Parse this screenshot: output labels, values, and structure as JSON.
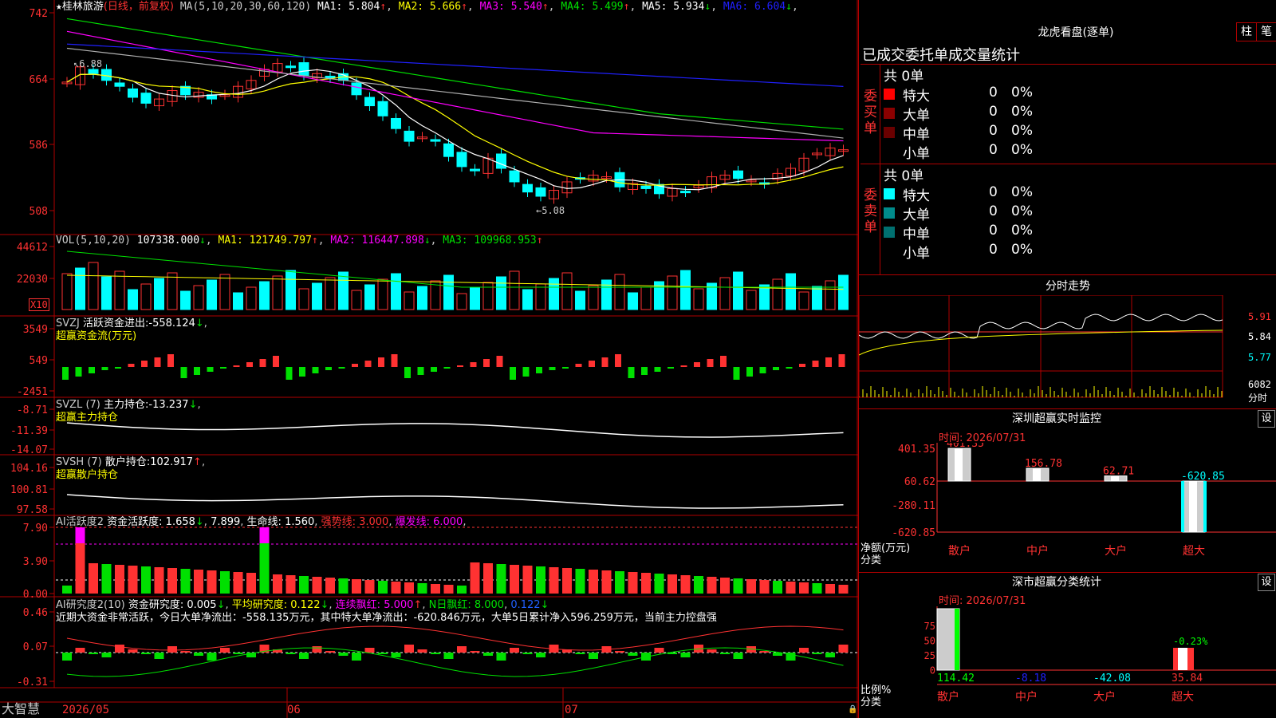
{
  "stock": {
    "star": "★",
    "name": "桂林旅游",
    "period": "(日线，前复权)",
    "ma_label": "MA(5,10,20,30,60,120)"
  },
  "colors": {
    "up": "#ff3232",
    "down": "#00ffff",
    "bg": "#000000",
    "grid": "#b00000",
    "white": "#ffffff",
    "yellow": "#ffff00",
    "magenta": "#ff00ff",
    "green": "#00e000",
    "blue": "#2020ff",
    "gray": "#b0b0b0"
  },
  "main_chart": {
    "ma_values": [
      {
        "label": "MA1:",
        "value": "5.804",
        "arrow": "↑",
        "color": "#ffffff"
      },
      {
        "label": "MA2:",
        "value": "5.666",
        "arrow": "↑",
        "color": "#ffff00"
      },
      {
        "label": "MA3:",
        "value": "5.540",
        "arrow": "↑",
        "color": "#ff00ff"
      },
      {
        "label": "MA4:",
        "value": "5.499",
        "arrow": "↑",
        "color": "#00e000"
      },
      {
        "label": "MA5:",
        "value": "5.934",
        "arrow": "↓",
        "color": "#ffffff"
      },
      {
        "label": "MA6:",
        "value": "6.604",
        "arrow": "↓",
        "color": "#2020ff"
      }
    ],
    "y_ticks": [
      "742",
      "664",
      "586",
      "508"
    ],
    "high_mark": "6.88",
    "low_mark": "5.08"
  },
  "vol_panel": {
    "label": "VOL(5,10,20)",
    "value": "107338.000",
    "arrow": "↓",
    "ma1": "MA1: 121749.797",
    "ma1_arrow": "↑",
    "ma2": "MA2: 116447.898",
    "ma2_arrow": "↓",
    "ma3": "MA3: 109968.953",
    "ma3_arrow": "↑",
    "y_ticks": [
      "44612",
      "22030"
    ],
    "unit": "X10"
  },
  "svzj_panel": {
    "name": "SVZJ",
    "title": "活跃资金进出:",
    "value": "-558.124",
    "arrow": "↓",
    "sub": "超赢资金流(万元)",
    "y_ticks": [
      "3549",
      "549",
      "-2451"
    ]
  },
  "svzl_panel": {
    "name": "SVZL",
    "param": "(7)",
    "title": "主力持仓:",
    "value": "-13.237",
    "arrow": "↓",
    "sub": "超赢主力持仓",
    "y_ticks": [
      "-8.71",
      "-11.39",
      "-14.07"
    ]
  },
  "svsh_panel": {
    "name": "SVSH",
    "param": "(7)",
    "title": "散户持仓:",
    "value": "102.917",
    "arrow": "↑",
    "sub": "超赢散户持仓",
    "y_ticks": [
      "104.16",
      "100.81",
      "97.58"
    ]
  },
  "ai_active_panel": {
    "label": "AI活跃度2",
    "t1": "资金活跃度:",
    "v1": "1.658",
    "a1": "↓",
    "v2": "7.899",
    "t3": "生命线:",
    "v3": "1.560",
    "t4": "强势线:",
    "v4": "3.000",
    "t5": "爆发线:",
    "v5": "6.000",
    "y_ticks": [
      "7.90",
      "3.90",
      "0.00"
    ]
  },
  "ai_research_panel": {
    "label": "AI研究度2(10)",
    "t1": "资金研究度:",
    "v1": "0.005",
    "a1": "↓",
    "t2": "平均研究度:",
    "v2": "0.122",
    "a2": "↓",
    "t3": "连续飘红:",
    "v3": "5.000",
    "a3": "↑",
    "t4": "N日飘红:",
    "v4": "8.000",
    "v5": "0.122",
    "a5": "↓",
    "summary": "近期大资金非常活跃，今日大单净流出：-558.135万元，其中特大单净流出：-620.846万元，大单5日累计净入596.259万元，当前主力控盘强",
    "y_ticks": [
      "0.46",
      "0.07",
      "-0.31"
    ]
  },
  "x_axis": {
    "labels": [
      "2026/05",
      "06",
      "07"
    ]
  },
  "brand": "大智慧",
  "lhb": {
    "title": "龙虎看盘(逐单)",
    "btn1": "柱",
    "btn2": "笔",
    "subtitle": "已成交委托单成交量统计",
    "buy": {
      "side": "委买单",
      "total": "共 0单",
      "rows": [
        {
          "name": "特大",
          "count": "0",
          "pct": "0%",
          "color": "#ff0000"
        },
        {
          "name": "大单",
          "count": "0",
          "pct": "0%",
          "color": "#8b0000"
        },
        {
          "name": "中单",
          "count": "0",
          "pct": "0%",
          "color": "#6a0000"
        },
        {
          "name": "小单",
          "count": "0",
          "pct": "0%",
          "color": "#000000"
        }
      ]
    },
    "sell": {
      "side": "委卖单",
      "total": "共 0单",
      "rows": [
        {
          "name": "特大",
          "count": "0",
          "pct": "0%",
          "color": "#00ffff"
        },
        {
          "name": "大单",
          "count": "0",
          "pct": "0%",
          "color": "#008b8b"
        },
        {
          "name": "中单",
          "count": "0",
          "pct": "0%",
          "color": "#007070"
        },
        {
          "name": "小单",
          "count": "0",
          "pct": "0%",
          "color": "#000000"
        }
      ]
    }
  },
  "intraday": {
    "title": "分时走势",
    "y_ticks": [
      "5.91",
      "5.84",
      "5.77"
    ],
    "vol_tick": "6082",
    "vol_label": "分时"
  },
  "monitor": {
    "title": "深圳超赢实时监控",
    "btn": "设",
    "date": "时间: 2026/07/31",
    "y_ticks": [
      "401.35",
      "60.62",
      "-280.11",
      "-620.85"
    ],
    "ylabel": "净额(万元)",
    "xlabel": "分类",
    "categories": [
      {
        "name": "散户",
        "value": 401.35,
        "label": "401.35"
      },
      {
        "name": "中户",
        "value": 156.78,
        "label": "156.78"
      },
      {
        "name": "大户",
        "value": 62.71,
        "label": "62.71"
      },
      {
        "name": "超大",
        "value": -620.85,
        "label": "-620.85"
      }
    ]
  },
  "classify": {
    "title": "深市超赢分类统计",
    "btn": "设",
    "date": "时间: 2026/07/31",
    "y_ticks": [
      "75",
      "50",
      "25",
      "0"
    ],
    "ylabel": "比例%",
    "xlabel": "分类",
    "pct_label": "-0.23%",
    "categories": [
      {
        "name": "散户",
        "value": "114.42",
        "color": "#00ff00"
      },
      {
        "name": "中户",
        "value": "-8.18",
        "color": "#2020ff"
      },
      {
        "name": "大户",
        "value": "-42.08",
        "color": "#00ffff"
      },
      {
        "name": "超大",
        "value": "35.84",
        "color": "#ff3232"
      }
    ]
  }
}
